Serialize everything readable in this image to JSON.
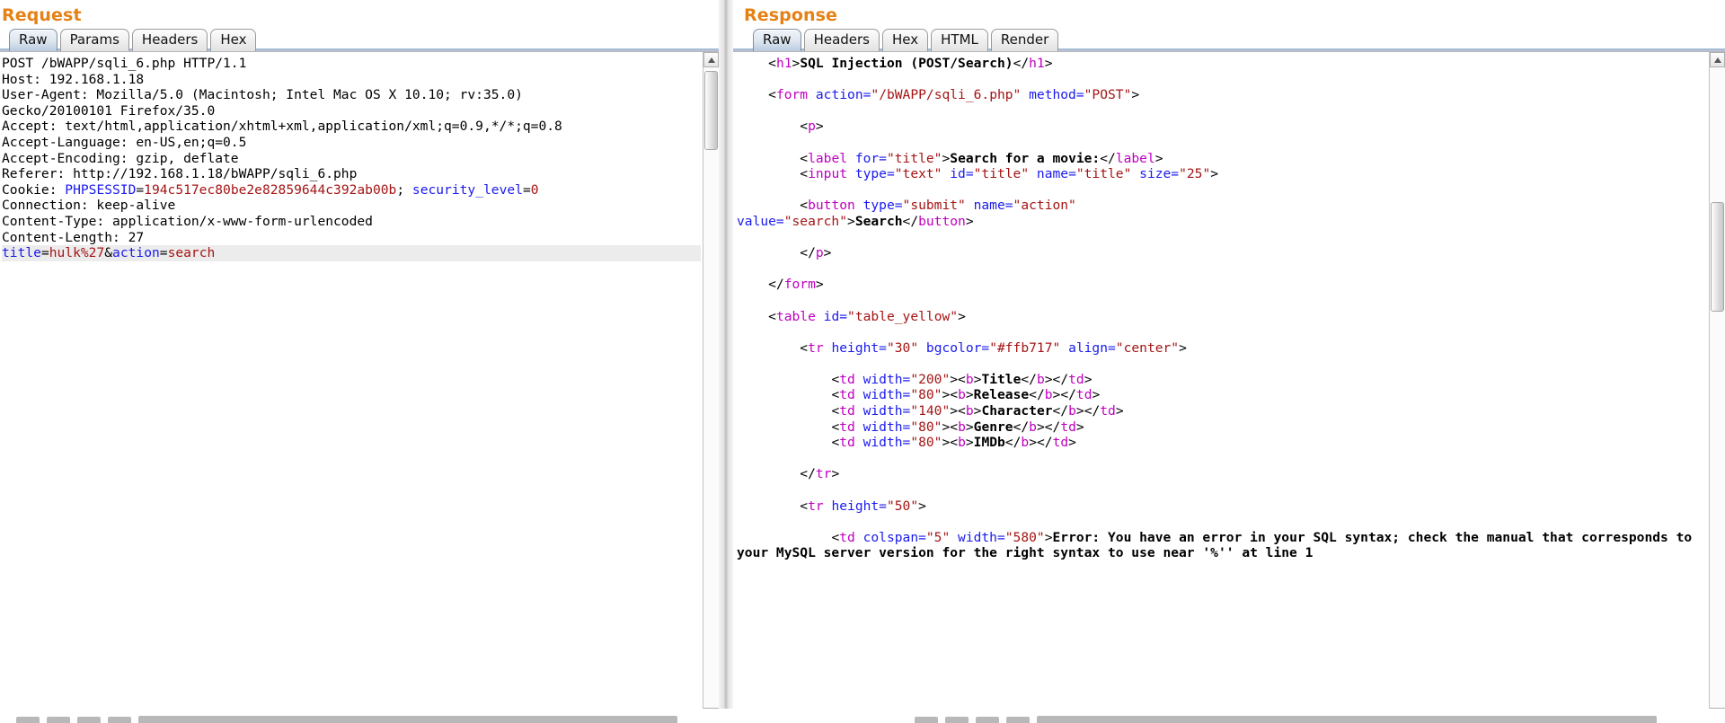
{
  "request": {
    "title": "Request",
    "tabs": [
      {
        "label": "Raw",
        "active": true
      },
      {
        "label": "Params",
        "active": false
      },
      {
        "label": "Headers",
        "active": false
      },
      {
        "label": "Hex",
        "active": false
      }
    ],
    "headers": [
      "POST /bWAPP/sqli_6.php HTTP/1.1",
      "Host: 192.168.1.18",
      "User-Agent: Mozilla/5.0 (Macintosh; Intel Mac OS X 10.10; rv:35.0)",
      "Gecko/20100101 Firefox/35.0",
      "Accept: text/html,application/xhtml+xml,application/xml;q=0.9,*/*;q=0.8",
      "Accept-Language: en-US,en;q=0.5",
      "Accept-Encoding: gzip, deflate",
      "Referer: http://192.168.1.18/bWAPP/sqli_6.php"
    ],
    "cookie_label": "Cookie: ",
    "cookie_name_1": "PHPSESSID",
    "cookie_value_1": "194c517ec80be2e82859644c392ab00b",
    "cookie_sep": "; ",
    "cookie_name_2": "security_level",
    "cookie_value_2": "0",
    "headers_tail": [
      "Connection: keep-alive",
      "Content-Type: application/x-www-form-urlencoded",
      "Content-Length: 27"
    ],
    "body": {
      "param1_name": "title",
      "param1_value": "hulk%27",
      "amp": "&",
      "param2_name": "action",
      "param2_value": "search"
    }
  },
  "response": {
    "title": "Response",
    "tabs": [
      {
        "label": "Raw",
        "active": true
      },
      {
        "label": "Headers",
        "active": false
      },
      {
        "label": "Hex",
        "active": false
      },
      {
        "label": "HTML",
        "active": false
      },
      {
        "label": "Render",
        "active": false
      }
    ],
    "lines": {
      "h1_open_lt": "<",
      "h1_open_name": "h1",
      "h1_open_gt": ">",
      "h1_text": "SQL Injection (POST/Search)",
      "h1_close": "</",
      "h1_close_name": "h1",
      "h1_close_gt": ">",
      "form_lt": "<",
      "form_name": "form",
      "form_attr1": " action=",
      "form_val1": "\"/bWAPP/sqli_6.php\"",
      "form_attr2": " method=",
      "form_val2": "\"POST\"",
      "form_gt": ">",
      "p_lt": "<",
      "p_name": "p",
      "p_gt": ">",
      "label_lt": "<",
      "label_name": "label",
      "label_attr": " for=",
      "label_val": "\"title\"",
      "label_gt": ">",
      "label_text": "Search for a movie:",
      "label_close_lt": "</",
      "label_close_name": "label",
      "label_close_gt": ">",
      "input_lt": "<",
      "input_name": "input",
      "input_a1": " type=",
      "input_v1": "\"text\"",
      "input_a2": " id=",
      "input_v2": "\"title\"",
      "input_a3": " name=",
      "input_v3": "\"title\"",
      "input_a4": " size=",
      "input_v4": "\"25\"",
      "input_gt": ">",
      "button_lt": "<",
      "button_name": "button",
      "button_a1": " type=",
      "button_v1": "\"submit\"",
      "button_a2": " name=",
      "button_v2": "\"action\"",
      "button_a3": "value=",
      "button_v3": "\"search\"",
      "button_gt": ">",
      "button_text": "Search",
      "button_close_lt": "</",
      "button_close_name": "button",
      "button_close_gt": ">",
      "p_close_lt": "</",
      "p_close_name": "p",
      "p_close_gt": ">",
      "form_close_lt": "</",
      "form_close_name": "form",
      "form_close_gt": ">",
      "table_lt": "<",
      "table_name": "table",
      "table_attr": " id=",
      "table_val": "\"table_yellow\"",
      "table_gt": ">",
      "tr1_lt": "<",
      "tr1_name": "tr",
      "tr1_a1": " height=",
      "tr1_v1": "\"30\"",
      "tr1_a2": " bgcolor=",
      "tr1_v2": "\"#ffb717\"",
      "tr1_a3": " align=",
      "tr1_v3": "\"center\"",
      "tr1_gt": ">",
      "tr1_close_lt": "</",
      "tr1_close_name": "tr",
      "tr1_close_gt": ">",
      "tr2_lt": "<",
      "tr2_name": "tr",
      "tr2_a1": " height=",
      "tr2_v1": "\"50\"",
      "tr2_gt": ">",
      "td_err_lt": "<",
      "td_err_name": "td",
      "td_err_a1": " colspan=",
      "td_err_v1": "\"5\"",
      "td_err_a2": " width=",
      "td_err_v2": "\"580\"",
      "td_err_gt": ">",
      "error_text": "Error: You have an error in your SQL syntax; check the manual that corresponds to your MySQL server version for the right syntax to use near '%'' at line 1"
    },
    "header_cells": [
      {
        "width": "\"200\"",
        "text": "Title"
      },
      {
        "width": "\"80\"",
        "text": "Release"
      },
      {
        "width": "\"140\"",
        "text": "Character"
      },
      {
        "width": "\"80\"",
        "text": "Genre"
      },
      {
        "width": "\"80\"",
        "text": "IMDb"
      }
    ]
  },
  "colors": {
    "panel_title": "#e58115",
    "tag": "#c000c0",
    "attribute": "#1a1aee",
    "value": "#a51414",
    "text": "#000000"
  }
}
